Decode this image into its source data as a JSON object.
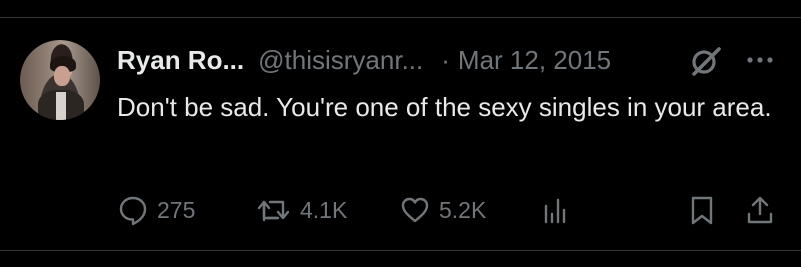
{
  "tweet": {
    "author_name": "Ryan Ro...",
    "handle": "@thisisryanr...",
    "separator": "·",
    "date": "Mar 12, 2015",
    "text": "Don't be sad. You're one of the sexy singles in your area.",
    "replies": "275",
    "retweets": "4.1K",
    "likes": "5.2K"
  },
  "icons": {
    "header": [
      "grok-icon",
      "more-icon"
    ],
    "actions": [
      "reply-icon",
      "retweet-icon",
      "like-icon",
      "views-icon",
      "bookmark-icon",
      "share-icon"
    ]
  },
  "colors": {
    "background": "#000000",
    "primary_text": "#e7e9ea",
    "secondary_text": "#71767b",
    "divider": "#2f3336"
  }
}
